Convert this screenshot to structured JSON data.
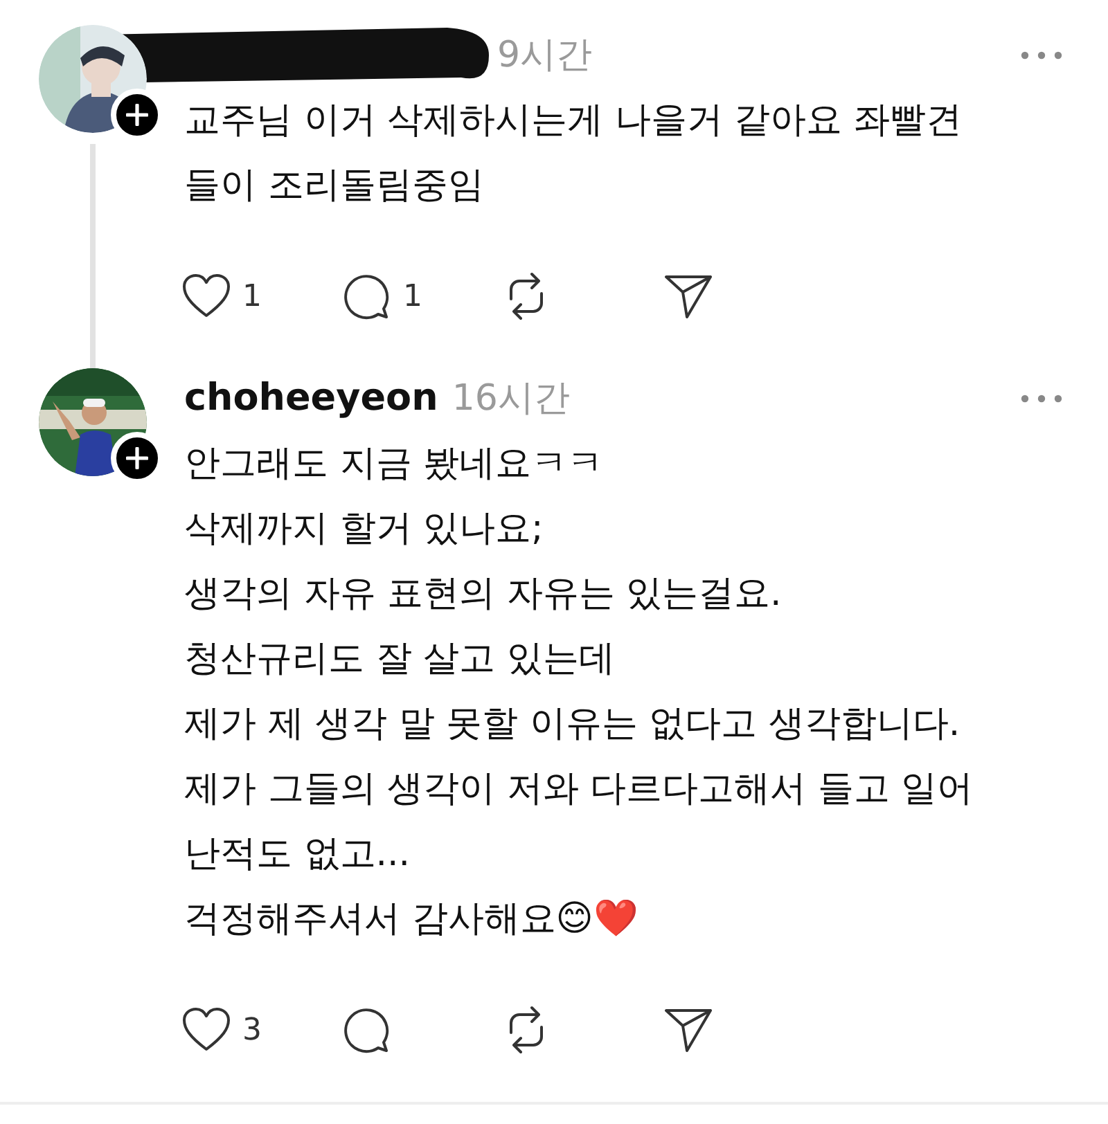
{
  "posts": [
    {
      "username_redacted": true,
      "time": "9시간",
      "thread_line": true,
      "lines": [
        "교주님 이거 삭제하시는게 나을거 같아요 좌빨견",
        "들이 조리돌림중임"
      ],
      "actions": [
        {
          "kind": "like",
          "count": "1"
        },
        {
          "kind": "comment",
          "count": "1"
        },
        {
          "kind": "repost"
        },
        {
          "kind": "share"
        }
      ]
    },
    {
      "username": "choheeyeon",
      "time": "16시간",
      "thread_line": false,
      "lines": [
        "안그래도 지금 봤네요ㅋㅋ",
        "삭제까지 할거 있나요;",
        "생각의 자유 표현의 자유는 있는걸요.",
        "청산규리도 잘 살고 있는데",
        "제가 제 생각 말 못할 이유는 없다고 생각합니다.",
        "제가 그들의 생각이 저와 다르다고해서 들고 일어",
        "난적도 없고...",
        "걱정해주셔서 감사해요😊❤️"
      ],
      "actions": [
        {
          "kind": "like",
          "count": "3"
        },
        {
          "kind": "comment"
        },
        {
          "kind": "repost"
        },
        {
          "kind": "share"
        }
      ]
    }
  ]
}
